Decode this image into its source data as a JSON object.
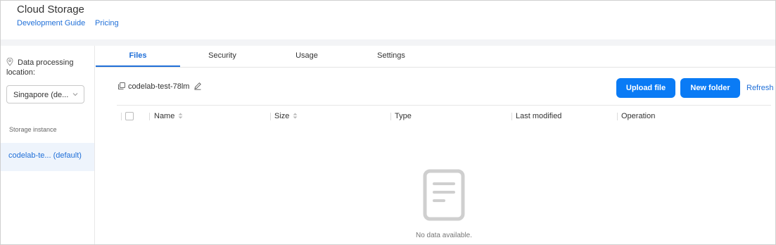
{
  "header": {
    "title": "Cloud Storage",
    "links": [
      "Development Guide",
      "Pricing"
    ]
  },
  "sidebar": {
    "location_label": "Data processing location:",
    "location_value": "Singapore  (de...",
    "storage_label": "Storage instance",
    "instance": "codelab-te...  (default)"
  },
  "tabs": [
    "Files",
    "Security",
    "Usage",
    "Settings"
  ],
  "active_tab": "Files",
  "bucket": {
    "name": "codelab-test-78lm"
  },
  "actions": {
    "upload": "Upload file",
    "new_folder": "New folder",
    "refresh": "Refresh"
  },
  "table": {
    "columns": [
      "Name",
      "Size",
      "Type",
      "Last modified",
      "Operation"
    ]
  },
  "empty": {
    "text": "No data available."
  },
  "colors": {
    "accent": "#0a7bf5",
    "link": "#1f6fd8",
    "selected_bg": "#eef4fc"
  }
}
